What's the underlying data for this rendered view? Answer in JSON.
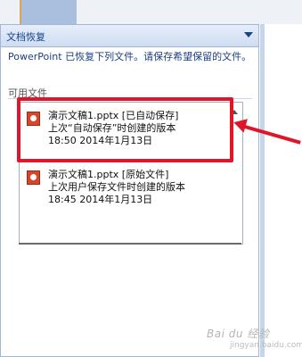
{
  "pane": {
    "title": "文档恢复",
    "message": "PowerPoint 已恢复下列文件。请保存希望保留的文件。",
    "section_label": "可用文件"
  },
  "files": [
    {
      "name_line": "演示文稿1.pptx  [已自动保存]",
      "desc_line": "上次“自动保存”时创建的版本",
      "time_line": "18:50 2014年1月13日"
    },
    {
      "name_line": "演示文稿1.pptx  [原始文件]",
      "desc_line": "上次用户保存文件时创建的版本",
      "time_line": "18:45 2014年1月13日"
    }
  ],
  "watermark": {
    "text": "Bai du 经验",
    "sub": "jingyan.baidu.com"
  },
  "colors": {
    "highlight": "#e0152a",
    "header_text": "#15428b"
  }
}
